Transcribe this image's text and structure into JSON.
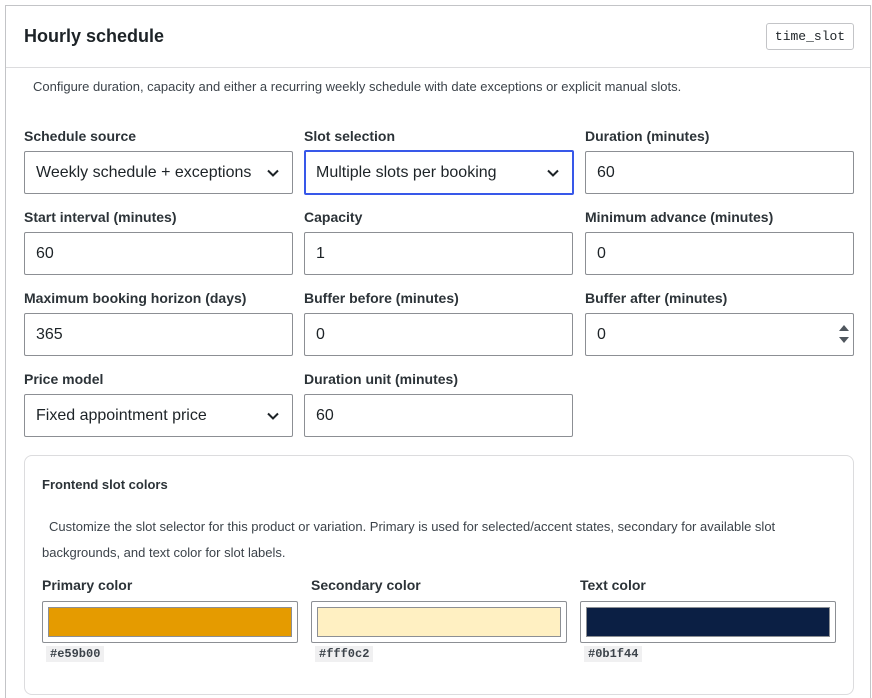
{
  "panel": {
    "title": "Hourly schedule",
    "type_badge": "time_slot",
    "description": "Configure duration, capacity and either a recurring weekly schedule with date exceptions or explicit manual slots."
  },
  "fields": {
    "schedule_source": {
      "label": "Schedule source",
      "value": "Weekly schedule + exceptions"
    },
    "slot_selection": {
      "label": "Slot selection",
      "value": "Multiple slots per booking"
    },
    "duration": {
      "label": "Duration (minutes)",
      "value": "60"
    },
    "start_interval": {
      "label": "Start interval (minutes)",
      "value": "60"
    },
    "capacity": {
      "label": "Capacity",
      "value": "1"
    },
    "minimum_advance": {
      "label": "Minimum advance (minutes)",
      "value": "0"
    },
    "max_horizon": {
      "label": "Maximum booking horizon (days)",
      "value": "365"
    },
    "buffer_before": {
      "label": "Buffer before (minutes)",
      "value": "0"
    },
    "buffer_after": {
      "label": "Buffer after (minutes)",
      "value": "0"
    },
    "price_model": {
      "label": "Price model",
      "value": "Fixed appointment price"
    },
    "duration_unit": {
      "label": "Duration unit (minutes)",
      "value": "60"
    }
  },
  "slot_colors": {
    "title": "Frontend slot colors",
    "description": "Customize the slot selector for this product or variation. Primary is used for selected/accent states, secondary for available slot backgrounds, and text color for slot labels.",
    "primary": {
      "label": "Primary color",
      "hex": "#e59b00"
    },
    "secondary": {
      "label": "Secondary color",
      "hex": "#fff0c2"
    },
    "text": {
      "label": "Text color",
      "hex": "#0b1f44"
    }
  },
  "theme": {
    "focus_accent": "#3858e9",
    "border": "#8c8f94"
  },
  "icons": {
    "select_arrow": "chevron-down-icon",
    "number_spinner": "spinner-arrows-icon"
  }
}
